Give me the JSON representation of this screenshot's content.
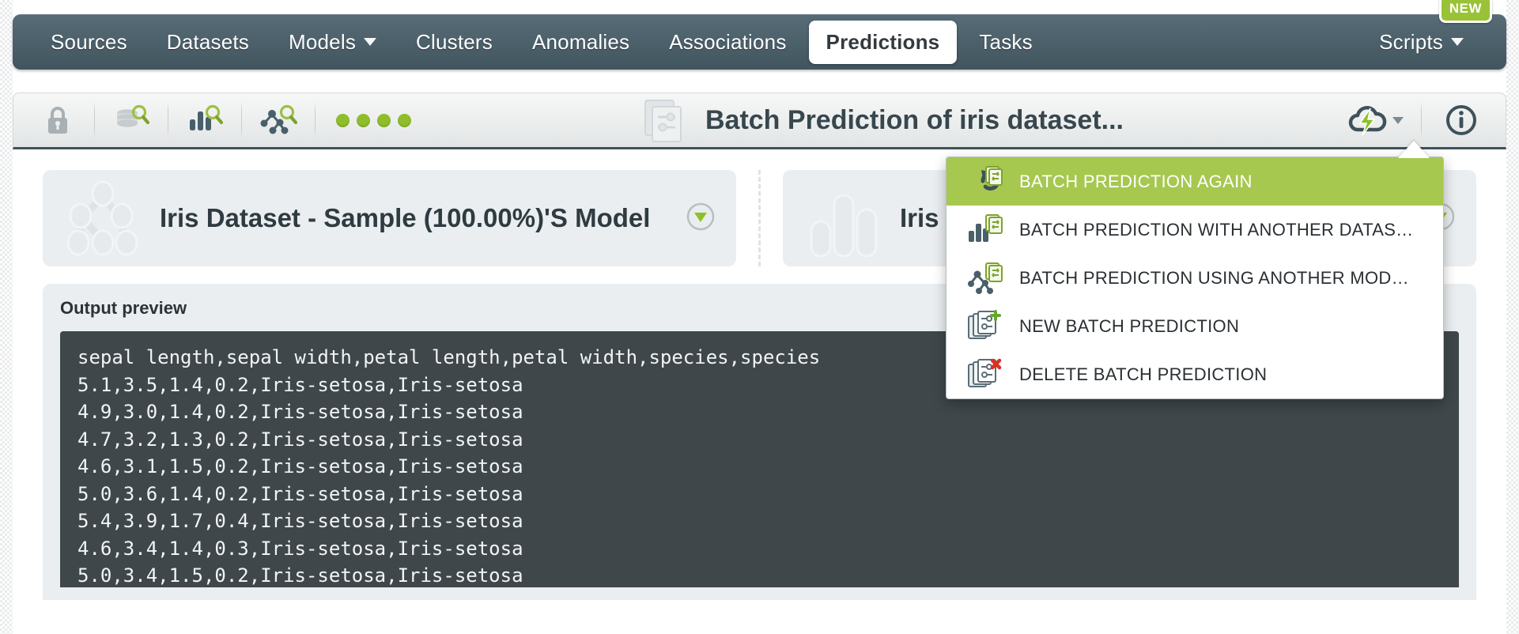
{
  "nav": {
    "items": [
      {
        "label": "Sources",
        "icon": "none",
        "active": false
      },
      {
        "label": "Datasets",
        "icon": "none",
        "active": false
      },
      {
        "label": "Models",
        "icon": "chevron-down-icon",
        "active": false
      },
      {
        "label": "Clusters",
        "icon": "none",
        "active": false
      },
      {
        "label": "Anomalies",
        "icon": "none",
        "active": false
      },
      {
        "label": "Associations",
        "icon": "none",
        "active": false
      },
      {
        "label": "Predictions",
        "icon": "none",
        "active": true
      },
      {
        "label": "Tasks",
        "icon": "none",
        "active": false
      }
    ],
    "right": {
      "label": "Scripts",
      "icon": "chevron-down-icon",
      "badge": "NEW"
    },
    "colors": {
      "bar_top": "#576c76",
      "bar_bottom": "#41555e",
      "badge": "#99c236"
    }
  },
  "toolbar": {
    "lock_label": "lock",
    "icons": [
      "lock-icon",
      "dataset-search-icon",
      "chart-search-icon",
      "model-search-icon"
    ],
    "status_dots": 4,
    "status_dot_color": "#8fbe2a",
    "title": "Batch Prediction of iris dataset...",
    "title_icon": "batch-prediction-icon",
    "cloud_action_icon": "cloud-lightning-icon",
    "info_icon": "info-icon"
  },
  "cards": [
    {
      "title": "Iris Dataset - Sample (100.00%)'S Model",
      "icon": "decision-tree-icon",
      "toggle": "collapse-toggle-icon"
    },
    {
      "title": "Iris D",
      "icon": "dataset-bars-icon",
      "toggle": "collapse-toggle-icon"
    }
  ],
  "output": {
    "title": "Output preview",
    "lines": [
      "sepal length,sepal width,petal length,petal width,species,species",
      "5.1,3.5,1.4,0.2,Iris-setosa,Iris-setosa",
      "4.9,3.0,1.4,0.2,Iris-setosa,Iris-setosa",
      "4.7,3.2,1.3,0.2,Iris-setosa,Iris-setosa",
      "4.6,3.1,1.5,0.2,Iris-setosa,Iris-setosa",
      "5.0,3.6,1.4,0.2,Iris-setosa,Iris-setosa",
      "5.4,3.9,1.7,0.4,Iris-setosa,Iris-setosa",
      "4.6,3.4,1.4,0.3,Iris-setosa,Iris-setosa",
      "5.0,3.4,1.5,0.2,Iris-setosa,Iris-setosa"
    ]
  },
  "menu": {
    "highlight_color": "#a6c84f",
    "items": [
      {
        "label": "BATCH PREDICTION AGAIN",
        "icon": "batch-prediction-again-icon",
        "highlighted": true
      },
      {
        "label": "BATCH PREDICTION WITH ANOTHER DATAS…",
        "icon": "batch-prediction-dataset-icon",
        "highlighted": false
      },
      {
        "label": "BATCH PREDICTION USING ANOTHER MOD…",
        "icon": "batch-prediction-model-icon",
        "highlighted": false
      },
      {
        "label": "NEW BATCH PREDICTION",
        "icon": "new-batch-prediction-icon",
        "highlighted": false
      },
      {
        "label": "DELETE BATCH PREDICTION",
        "icon": "delete-batch-prediction-icon",
        "highlighted": false
      }
    ]
  }
}
